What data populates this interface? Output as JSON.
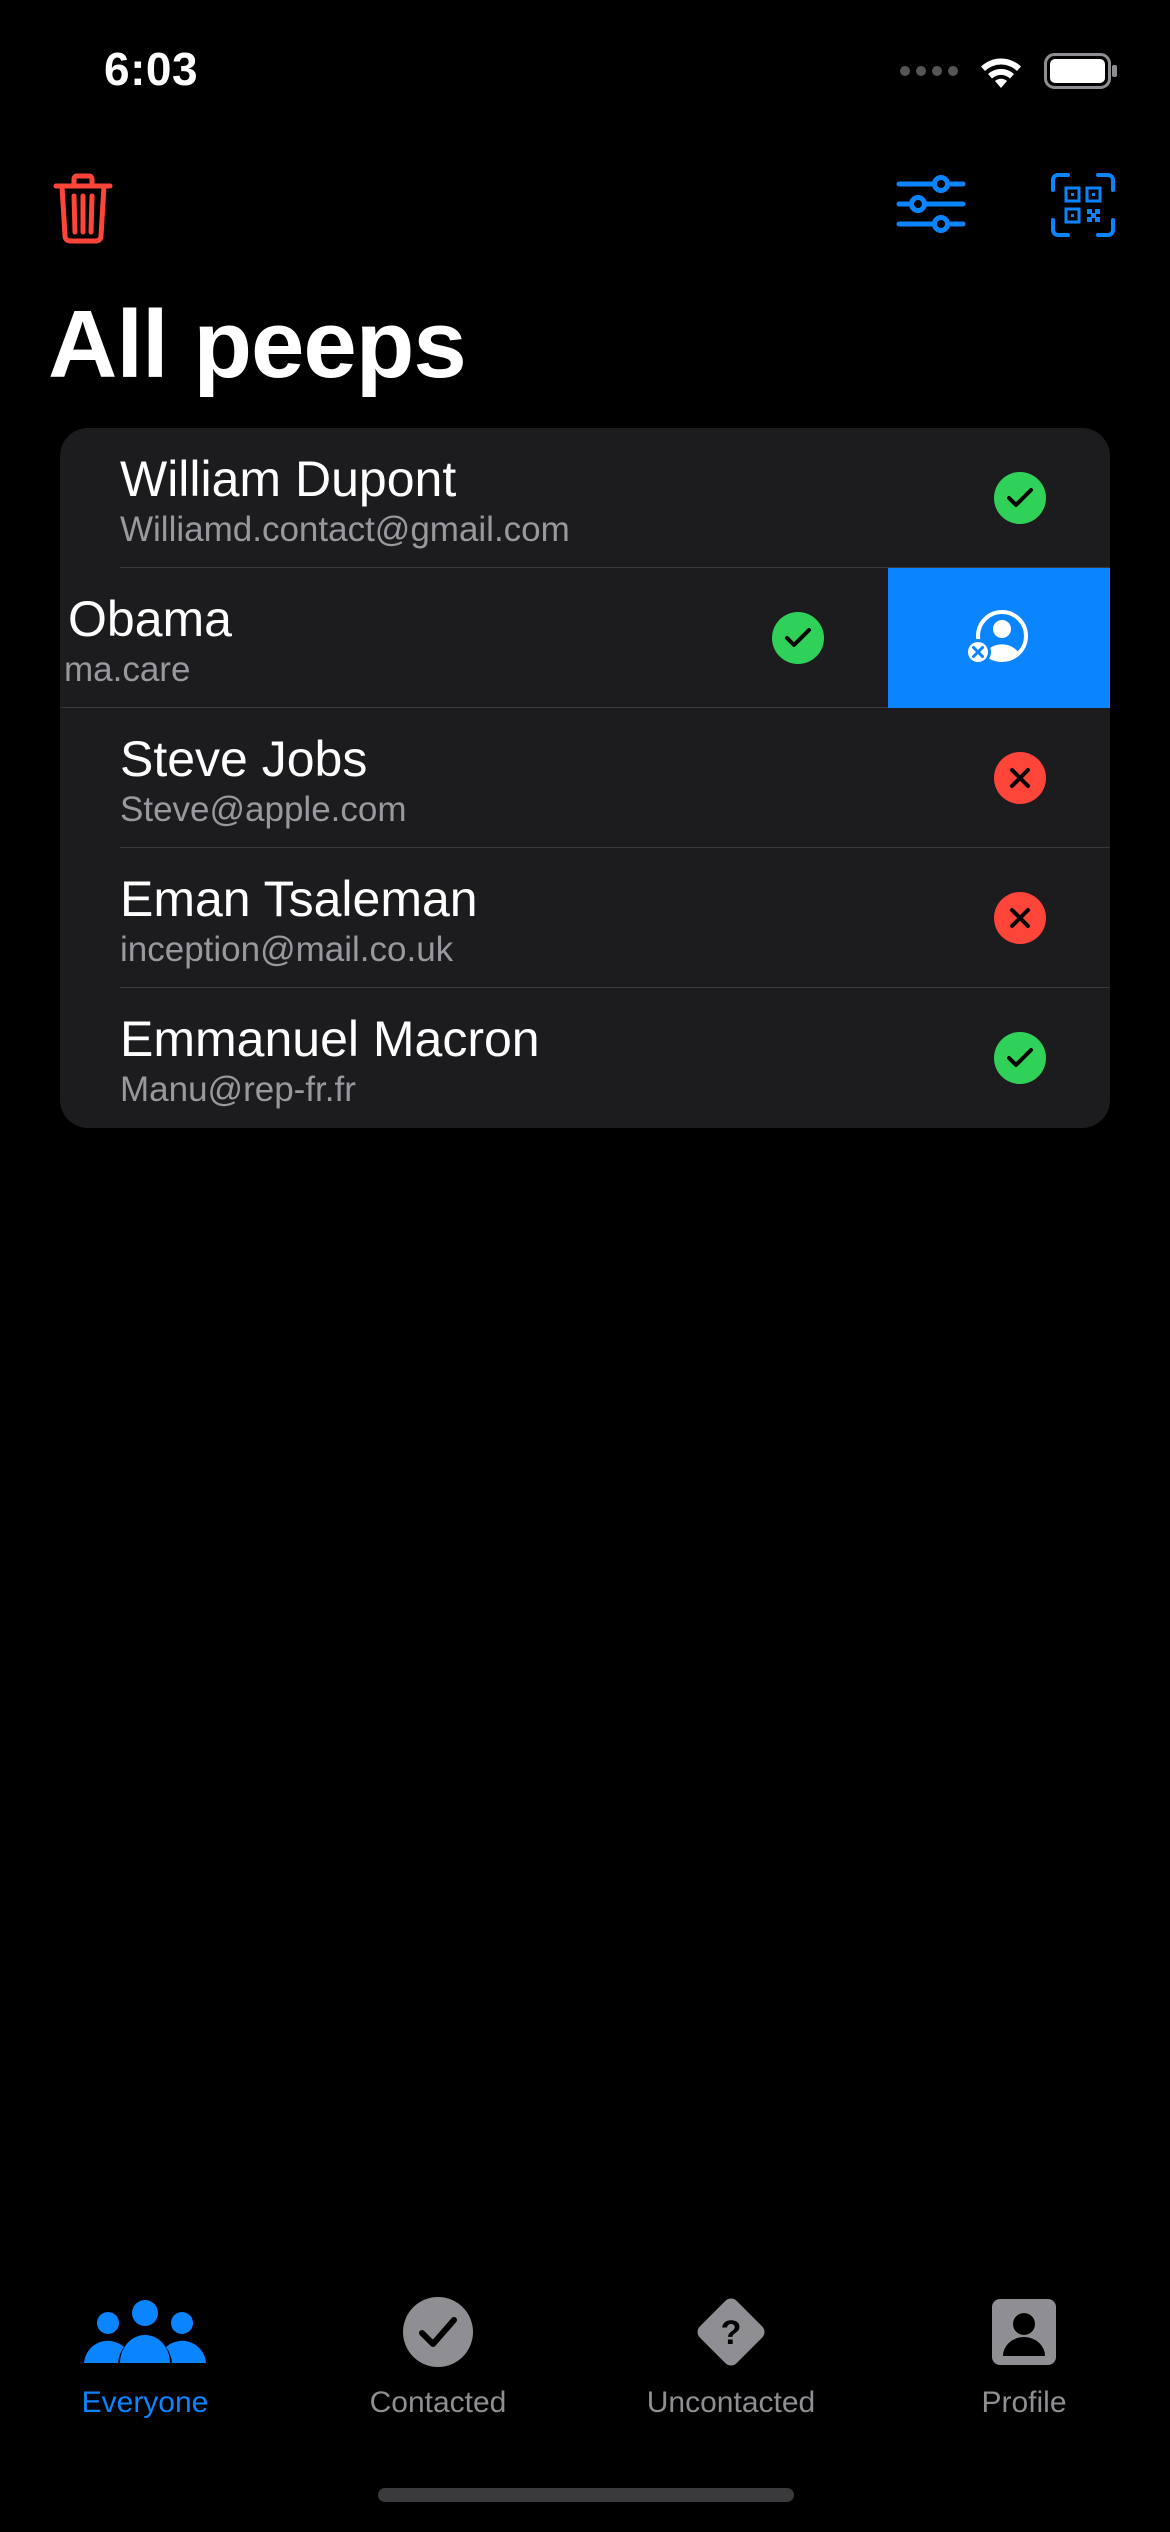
{
  "status_bar": {
    "time": "6:03"
  },
  "nav": {
    "title": "All peeps",
    "icons": {
      "delete": "trash-icon",
      "filter": "sliders-icon",
      "scan": "qr-code-icon"
    },
    "colors": {
      "delete": "#ff453a",
      "accent": "#0a84ff"
    }
  },
  "people": [
    {
      "name": "William Dupont",
      "email": "Williamd.contact@gmail.com",
      "status": "contacted"
    },
    {
      "name": "Obama",
      "email": "ma.care",
      "status": "contacted",
      "swiped": true,
      "swipe_action_icon": "remove-contact-icon"
    },
    {
      "name": "Steve Jobs",
      "email": "Steve@apple.com",
      "status": "uncontacted"
    },
    {
      "name": "Eman Tsaleman",
      "email": "inception@mail.co.uk",
      "status": "uncontacted"
    },
    {
      "name": "Emmanuel Macron",
      "email": "Manu@rep-fr.fr",
      "status": "contacted"
    }
  ],
  "status_colors": {
    "contacted": "#30d158",
    "uncontacted": "#ff453a"
  },
  "tabbar": {
    "tabs": [
      {
        "label": "Everyone",
        "icon": "people-group-icon",
        "active": true
      },
      {
        "label": "Contacted",
        "icon": "checkmark-circle-icon",
        "active": false
      },
      {
        "label": "Uncontacted",
        "icon": "question-diamond-icon",
        "active": false
      },
      {
        "label": "Profile",
        "icon": "person-square-icon",
        "active": false
      }
    ]
  }
}
